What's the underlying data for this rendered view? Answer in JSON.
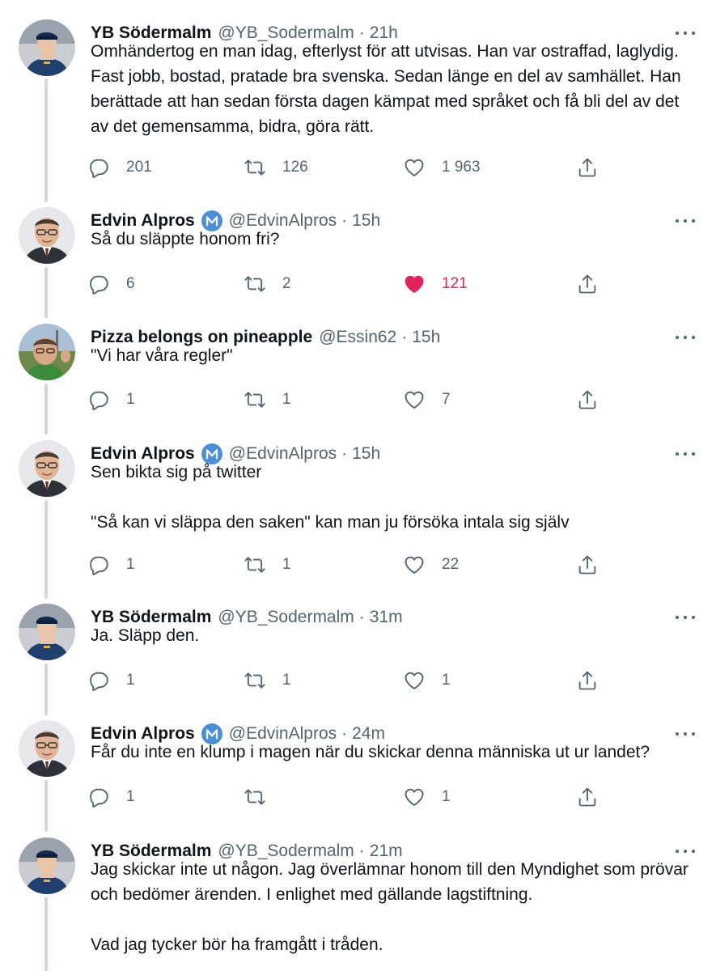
{
  "colors": {
    "text": "#0f1419",
    "secondary": "#536471",
    "line": "#cfd9de",
    "like_active": "#e0245e",
    "badge": "#4a90d9"
  },
  "tweets": [
    {
      "name": "YB Södermalm",
      "handle": "@YB_Sodermalm",
      "sep": "·",
      "time": "21h",
      "badge": false,
      "avatar": "police-avatar",
      "text": "Omhändertog en man idag, efterlyst för att utvisas. Han var ostraffad, laglydig. Fast jobb, bostad, pratade bra svenska. Sedan länge en del av samhället. Han berättade att han sedan första dagen kämpat med språket och få bli del av det av det gemensamma, bidra, göra rätt.",
      "replies": "201",
      "retweets": "126",
      "likes": "1 963",
      "liked": false
    },
    {
      "name": "Edvin Alpros",
      "handle": "@EdvinAlpros",
      "sep": "·",
      "time": "15h",
      "badge": true,
      "avatar": "man-glasses-avatar",
      "text": "Så du släppte honom fri?",
      "replies": "6",
      "retweets": "2",
      "likes": "121",
      "liked": true
    },
    {
      "name": "Pizza belongs on pineapple",
      "handle": "@Essin62",
      "sep": "·",
      "time": "15h",
      "badge": false,
      "avatar": "selfie-avatar",
      "text": "\"Vi har våra regler\"",
      "replies": "1",
      "retweets": "1",
      "likes": "7",
      "liked": false
    },
    {
      "name": "Edvin Alpros",
      "handle": "@EdvinAlpros",
      "sep": "·",
      "time": "15h",
      "badge": true,
      "avatar": "man-glasses-avatar",
      "text": "Sen bikta sig på twitter\n\n\"Så kan vi släppa den saken\" kan man ju försöka intala sig själv",
      "replies": "1",
      "retweets": "1",
      "likes": "22",
      "liked": false
    },
    {
      "name": "YB Södermalm",
      "handle": "@YB_Sodermalm",
      "sep": "·",
      "time": "31m",
      "badge": false,
      "avatar": "police-avatar",
      "text": "Ja. Släpp den.",
      "replies": "1",
      "retweets": "1",
      "likes": "1",
      "liked": false
    },
    {
      "name": "Edvin Alpros",
      "handle": "@EdvinAlpros",
      "sep": "·",
      "time": "24m",
      "badge": true,
      "avatar": "man-glasses-avatar",
      "text": "Får du inte en klump i magen när du skickar denna människa ut ur landet?",
      "replies": "1",
      "retweets": "",
      "likes": "1",
      "liked": false
    },
    {
      "name": "YB Södermalm",
      "handle": "@YB_Sodermalm",
      "sep": "·",
      "time": "21m",
      "badge": false,
      "avatar": "police-avatar",
      "text": "Jag skickar inte ut någon. Jag överlämnar honom till den Myndighet som prövar och bedömer ärenden. I enlighet med gällande lagstiftning.\n\nVad jag tycker bör ha framgått i tråden.",
      "replies": "",
      "retweets": "",
      "likes": "",
      "liked": false
    }
  ]
}
